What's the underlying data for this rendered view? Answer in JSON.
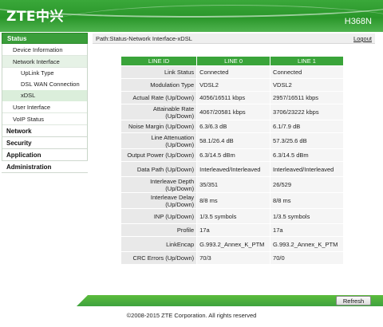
{
  "header": {
    "logo": "ZTE中兴",
    "model": "H368N"
  },
  "sidebar": {
    "status": "Status",
    "device_information": "Device Information",
    "network_interface": "Network Interface",
    "uplink_type": "UpLink Type",
    "dsl_wan_connection": "DSL WAN Connection",
    "xdsl": "xDSL",
    "user_interface": "User Interface",
    "voip_status": "VoIP Status",
    "network": "Network",
    "security": "Security",
    "application": "Application",
    "administration": "Administration"
  },
  "pathbar": {
    "path": "Path:Status-Network Interface-xDSL",
    "logout": "Logout"
  },
  "table": {
    "headers": [
      "LINE ID",
      "LINE 0",
      "LINE 1"
    ],
    "rows": [
      {
        "label": "Link Status",
        "line0": "Connected",
        "line1": "Connected"
      },
      {
        "label": "Modulation Type",
        "line0": "VDSL2",
        "line1": "VDSL2"
      },
      {
        "label": "Actual Rate (Up/Down)",
        "line0": "4056/16511 kbps",
        "line1": "2957/16511 kbps"
      },
      {
        "label": "Attainable Rate (Up/Down)",
        "line0": "4067/20581 kbps",
        "line1": "3706/23222 kbps"
      },
      {
        "label": "Noise Margin (Up/Down)",
        "line0": "6.3/6.3 dB",
        "line1": "6.1/7.9 dB"
      },
      {
        "label": "Line Attenuation (Up/Down)",
        "line0": "58.1/26.4 dB",
        "line1": "57.3/25.6 dB"
      },
      {
        "label": "Output Power (Up/Down)",
        "line0": "6.3/14.5 dBm",
        "line1": "6.3/14.5 dBm"
      },
      {
        "label": "Data Path (Up/Down)",
        "line0": "Interleaved/Interleaved",
        "line1": "Interleaved/Interleaved"
      },
      {
        "label": "Interleave Depth (Up/Down)",
        "line0": "35/351",
        "line1": "26/529"
      },
      {
        "label": "Interleave Delay (Up/Down)",
        "line0": "8/8 ms",
        "line1": "8/8 ms"
      },
      {
        "label": "INP (Up/Down)",
        "line0": "1/3.5 symbols",
        "line1": "1/3.5 symbols"
      },
      {
        "label": "Profile",
        "line0": "17a",
        "line1": "17a"
      },
      {
        "label": "LinkEncap",
        "line0": "G.993.2_Annex_K_PTM",
        "line1": "G.993.2_Annex_K_PTM"
      },
      {
        "label": "CRC Errors (Up/Down)",
        "line0": "70/3",
        "line1": "70/0"
      }
    ]
  },
  "footer": {
    "refresh": "Refresh",
    "copyright": "©2008-2015 ZTE Corporation. All rights reserved"
  }
}
